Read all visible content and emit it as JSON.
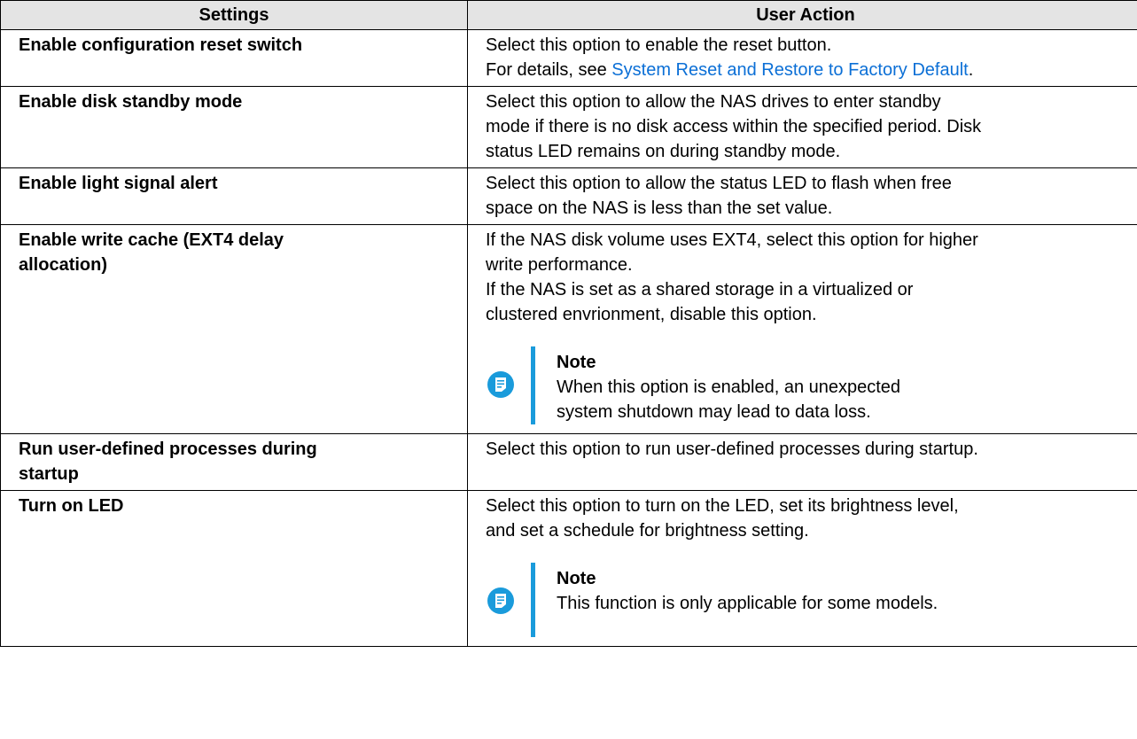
{
  "table": {
    "headers": [
      "Settings",
      "User Action"
    ],
    "rows": [
      {
        "setting": "Enable configuration reset switch",
        "action_lines": [
          "Select this option to enable the reset button."
        ],
        "action_prefix": "For details, see ",
        "action_link": "System Reset and Restore to Factory Default",
        "action_suffix": "."
      },
      {
        "setting": "Enable disk standby mode",
        "action_lines": [
          "Select this option to allow the NAS drives to enter standby",
          "mode if there is no disk access within the specified period. Disk",
          "status LED remains on during standby mode."
        ]
      },
      {
        "setting": "Enable light signal alert",
        "action_lines": [
          "Select this option to allow the status LED to flash when free",
          "space on the NAS is less than the set value."
        ]
      },
      {
        "setting_lines": [
          "Enable write cache (EXT4 delay",
          "allocation)"
        ],
        "action_lines": [
          "If the NAS disk volume uses EXT4, select this option for higher",
          "write performance.",
          "If the NAS is set as a shared storage in a virtualized or",
          "clustered envrionment, disable this option."
        ],
        "note_title": "Note",
        "note_lines": [
          "When this option is enabled, an unexpected",
          "system shutdown may lead to data loss."
        ]
      },
      {
        "setting_lines": [
          "Run user-defined processes during",
          "startup"
        ],
        "action_lines": [
          "Select this option to run user-defined processes during startup."
        ]
      },
      {
        "setting": "Turn on LED",
        "action_lines": [
          "Select this option to turn on the LED, set its brightness level,",
          "and set a schedule for brightness setting."
        ],
        "note_title": "Note",
        "note_lines": [
          "This function is only applicable for some models."
        ]
      }
    ]
  },
  "icons": {
    "note": "note-icon"
  },
  "colors": {
    "header_bg": "#e4e4e4",
    "link": "#0b6fd6",
    "note_accent": "#1a9bdb"
  }
}
